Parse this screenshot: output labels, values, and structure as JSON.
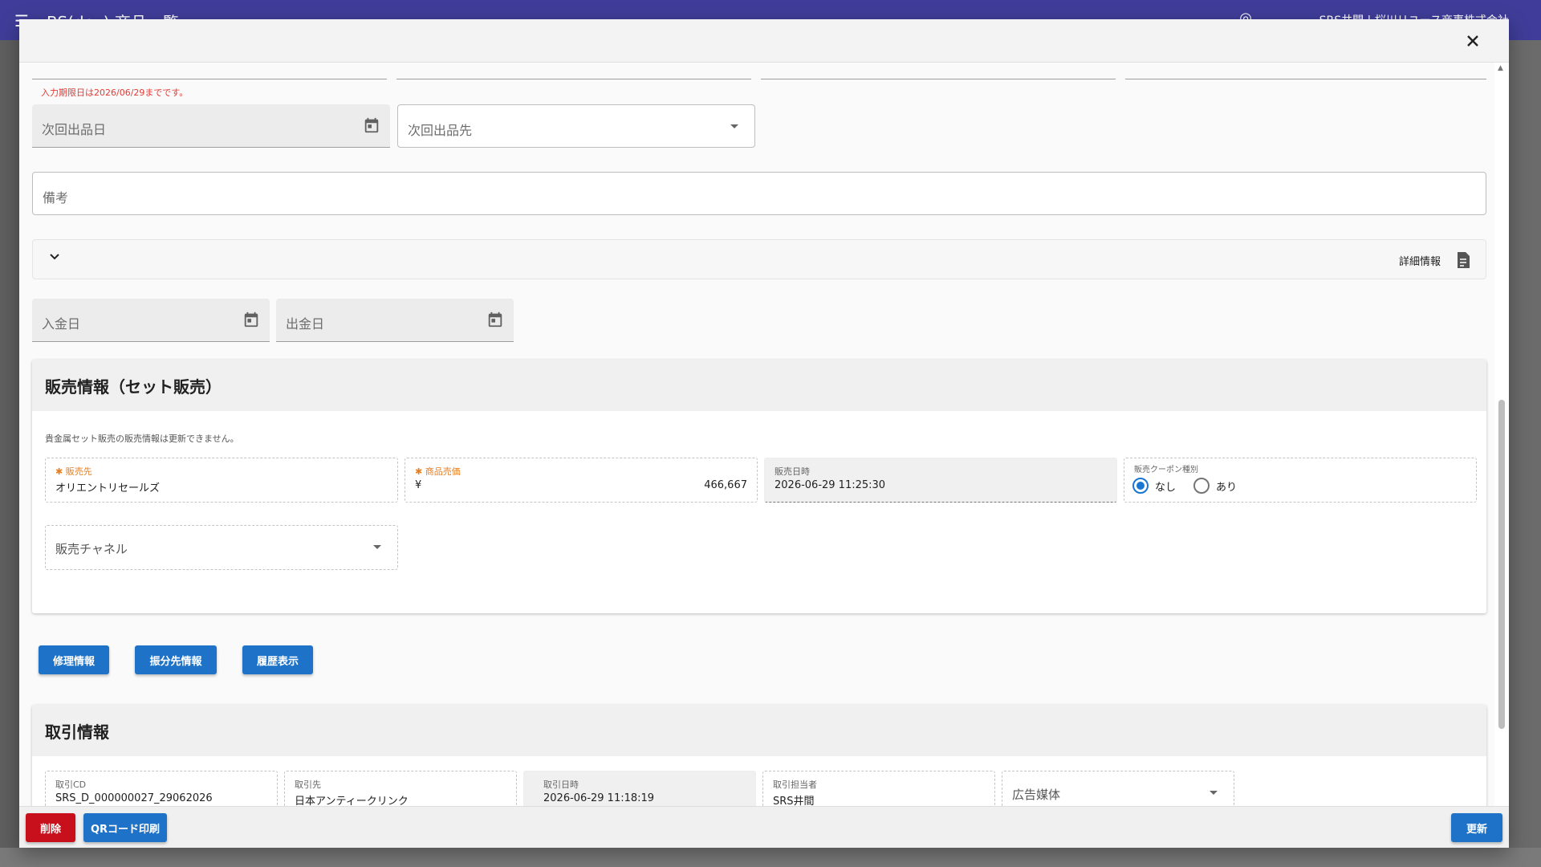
{
  "app": {
    "title": "BS(dev) 商品一覧",
    "user": "SRS井間 | 桜川リユース商事株式会社"
  },
  "form": {
    "error_text": "入力期限日は2026/06/29までです。",
    "next_date_label": "次回出品日",
    "next_dest_label": "次回出品先",
    "remarks_label": "備考",
    "detail_label": "詳細情報",
    "deposit_date_label": "入金日",
    "withdraw_date_label": "出金日"
  },
  "sales": {
    "title": "販売情報（セット販売）",
    "note": "貴金属セット販売の販売情報は更新できません。",
    "buyer_label": "販売先",
    "buyer_value": "オリエントリセールズ",
    "price_label": "商品売価",
    "price_currency": "¥",
    "price_value": "466,667",
    "sold_at_label": "販売日時",
    "sold_at_value": "2026-06-29 11:25:30",
    "coupon_label": "販売クーポン種別",
    "coupon_options": [
      "なし",
      "あり"
    ],
    "coupon_selected": "なし",
    "channel_label": "販売チャネル"
  },
  "actions": {
    "repair": "修理情報",
    "allocation": "振分先情報",
    "history": "履歴表示"
  },
  "trade": {
    "title": "取引情報",
    "cd_label": "取引CD",
    "cd_value": "SRS_D_000000027_29062026",
    "partner_label": "取引先",
    "partner_value": "日本アンティークリンク",
    "datetime_label": "取引日時",
    "datetime_value": "2026-06-29 11:18:19",
    "staff_label": "取引担当者",
    "staff_value": "SRS井間",
    "media_label": "広告媒体"
  },
  "footer": {
    "delete": "削除",
    "qr_print": "QRコード印刷",
    "update": "更新"
  },
  "colors": {
    "primary": "#1e73c9",
    "danger": "#c8101d",
    "app_bar": "#3f3d99",
    "required": "#e67e22",
    "error": "#e53935"
  }
}
